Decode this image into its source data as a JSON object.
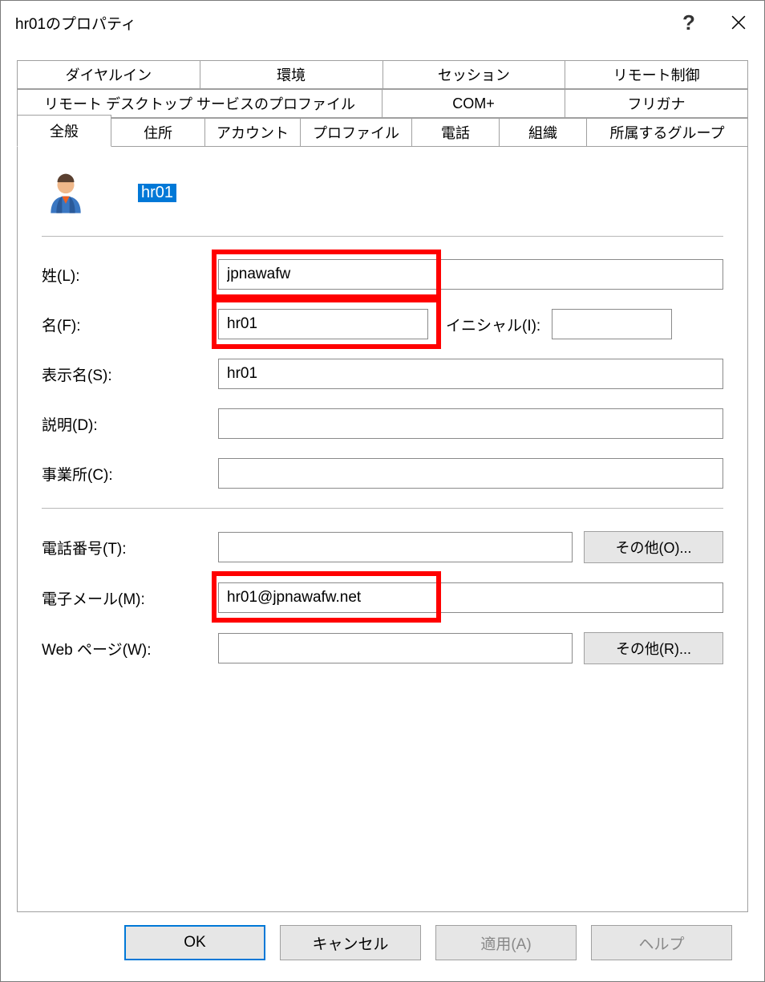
{
  "window": {
    "title": "hr01のプロパティ"
  },
  "tabs": {
    "row1": [
      "ダイヤルイン",
      "環境",
      "セッション",
      "リモート制御"
    ],
    "row2": [
      "リモート デスクトップ サービスのプロファイル",
      "COM+",
      "フリガナ"
    ],
    "row3": [
      "全般",
      "住所",
      "アカウント",
      "プロファイル",
      "電話",
      "組織",
      "所属するグループ"
    ]
  },
  "user": {
    "name": "hr01"
  },
  "fields": {
    "lastname_label": "姓(L):",
    "lastname_value": "jpnawafw",
    "firstname_label": "名(F):",
    "firstname_value": "hr01",
    "initials_label": "イニシャル(I):",
    "initials_value": "",
    "displayname_label": "表示名(S):",
    "displayname_value": "hr01",
    "description_label": "説明(D):",
    "description_value": "",
    "office_label": "事業所(C):",
    "office_value": "",
    "phone_label": "電話番号(T):",
    "phone_value": "",
    "phone_other": "その他(O)...",
    "email_label": "電子メール(M):",
    "email_value": "hr01@jpnawafw.net",
    "web_label": "Web ページ(W):",
    "web_value": "",
    "web_other": "その他(R)..."
  },
  "buttons": {
    "ok": "OK",
    "cancel": "キャンセル",
    "apply": "適用(A)",
    "help": "ヘルプ"
  }
}
